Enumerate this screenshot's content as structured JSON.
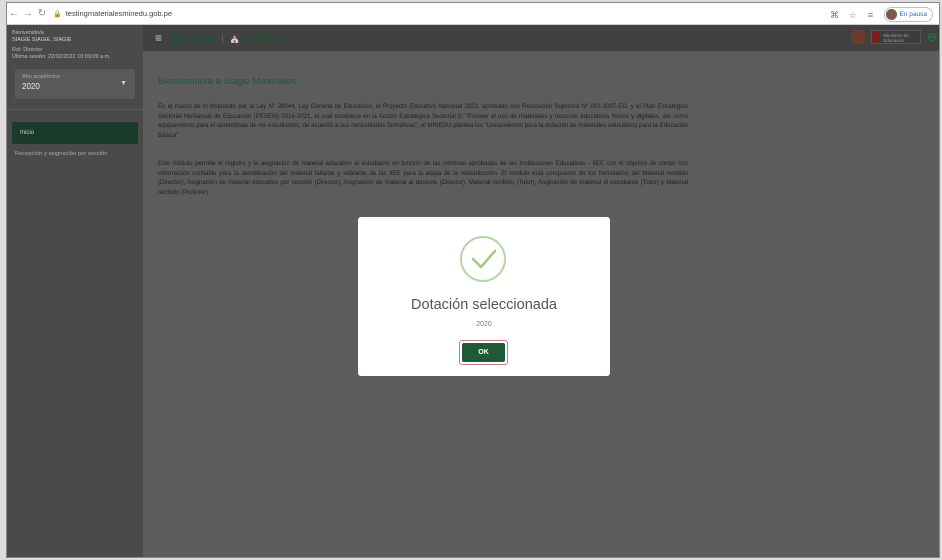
{
  "browser": {
    "url": "testingmaterialesminedu.gob.pe",
    "profile_label": "En pausa"
  },
  "sidebar": {
    "greeting": "Bienvenido/a",
    "user_name": "SIAGIE SIAGIE, SIAGIE",
    "role": "Rol: Director",
    "last_session": "Última sesión: 22/02/2022 10:09:09 a.m.",
    "year_label": "Año académico",
    "year_value": "2020",
    "items": [
      {
        "label": "Inicio"
      },
      {
        "label": "Recepción y asignación por sección"
      }
    ]
  },
  "header": {
    "brand": "siagie",
    "separator": "|",
    "module": "Materiales",
    "ministry": "Ministerio de Educación"
  },
  "main": {
    "title": "Bienvenido/a a Siagie Materiales",
    "paragraph1": "En el marco de lo dispuesto por la Ley N° 28044, Ley General de Educación, el Proyecto Educativo Nacional 2021, aprobado con Resolución Suprema N° 001-2007-ED, y el Plan Estratégico Sectorial Multianual de Educación (PESEM) 2016-2021, el cual establece en la Acción Estratégica Sectorial 5: \"Proveer el uso de materiales y recursos educativos físicos y digitales, así como equipamiento para el aprendizaje de los estudiantes, de acuerdo a sus necesidades formativas\", el MINEDU plantea los \"Lineamientos para la dotación de materiales educativos para la Educación Básica\".",
    "paragraph2": "Este módulo permite el registro y la asignación de material educativo al estudiante en función de las nóminas aprobadas de las Instituciones Educativas - IIEE con el objetivo de contar con información confiable para la identificación del material faltante y sobrante de las IIEE para la etapa de la redistribución. El módulo está compuesto de los formularios del Material recibido (Director), Asignación de material educativo por sección (Director), Asignación de material al docente (Director), Material recibido (Tutor), Asignación de material al estudiante (Tutor) y Material recibido (Profesor)."
  },
  "modal": {
    "title": "Dotación seleccionada",
    "subtitle": "2020",
    "ok_label": "OK"
  }
}
